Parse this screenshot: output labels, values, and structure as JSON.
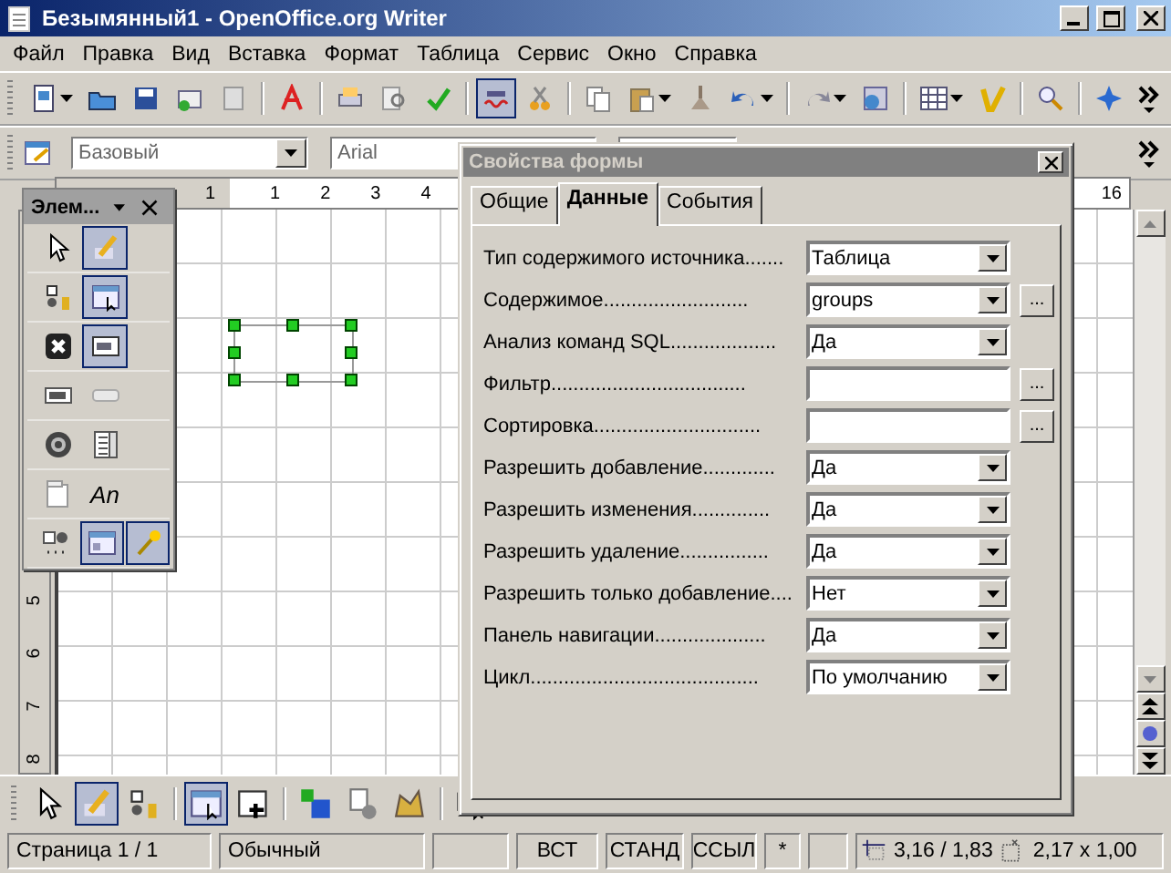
{
  "window": {
    "title": "Безымянный1 - OpenOffice.org Writer"
  },
  "menu": [
    {
      "label": "Файл"
    },
    {
      "label": "Правка"
    },
    {
      "label": "Вид"
    },
    {
      "label": "Вставка"
    },
    {
      "label": "Формат"
    },
    {
      "label": "Таблица"
    },
    {
      "label": "Сервис"
    },
    {
      "label": "Окно"
    },
    {
      "label": "Справка"
    }
  ],
  "standard_toolbar": {
    "buttons": [
      {
        "selected": false
      },
      {
        "selected": false
      },
      {
        "selected": false
      },
      {
        "selected": false
      },
      {
        "selected": false
      },
      {
        "selected": false
      },
      {
        "selected": false
      },
      {
        "selected": false
      },
      {
        "selected": false
      },
      {
        "selected": true
      },
      {
        "selected": false
      },
      {
        "selected": false
      },
      {
        "selected": false
      },
      {
        "selected": false
      },
      {
        "selected": false
      },
      {
        "selected": false
      },
      {
        "selected": false
      },
      {
        "selected": false
      },
      {
        "selected": false
      },
      {
        "selected": false
      },
      {
        "selected": false
      }
    ]
  },
  "formatting_toolbar": {
    "style": "Базовый",
    "font": "Arial"
  },
  "horizontal_ruler": [
    "1",
    "1",
    "2",
    "3",
    "4",
    "16"
  ],
  "vertical_ruler": [
    "5",
    "6",
    "7",
    "8"
  ],
  "form_controls_toolbar": {
    "title": "Элем...",
    "tools": [
      {
        "selected": false
      },
      {
        "selected": true
      },
      {
        "selected": false
      },
      {
        "selected": true
      },
      {
        "selected": false
      },
      {
        "selected": true
      },
      {
        "selected": false
      },
      {
        "selected": false
      },
      {
        "selected": false
      },
      {
        "selected": false
      },
      {
        "selected": false
      },
      {
        "selected": false,
        "text": "An"
      },
      {
        "selected": false
      },
      {
        "selected": true
      },
      {
        "selected": true
      }
    ]
  },
  "form_design_toolbar": {
    "buttons": [
      {
        "selected": false
      },
      {
        "selected": true
      },
      {
        "selected": false
      },
      {
        "selected": true
      },
      {
        "selected": false
      },
      {
        "selected": false
      },
      {
        "selected": false
      },
      {
        "selected": false
      },
      {
        "selected": false
      }
    ]
  },
  "dialog": {
    "title": "Свойства формы",
    "tabs": [
      {
        "label": "Общие",
        "selected": false
      },
      {
        "label": "Данные",
        "selected": true
      },
      {
        "label": "События",
        "selected": false
      }
    ],
    "rows": [
      {
        "label": "Тип содержимого источника.......",
        "kind": "combo",
        "value": "Таблица"
      },
      {
        "label": "Содержимое..........................",
        "kind": "combo",
        "value": "groups",
        "browse": "..."
      },
      {
        "label": "Анализ команд SQL...................",
        "kind": "combo",
        "value": "Да"
      },
      {
        "label": "Фильтр...................................",
        "kind": "text",
        "value": "",
        "browse": "..."
      },
      {
        "label": "Сортировка..............................",
        "kind": "text",
        "value": "",
        "browse": "..."
      },
      {
        "label": "Разрешить добавление.............",
        "kind": "combo",
        "value": "Да"
      },
      {
        "label": "Разрешить изменения..............",
        "kind": "combo",
        "value": "Да"
      },
      {
        "label": "Разрешить удаление................",
        "kind": "combo",
        "value": "Да"
      },
      {
        "label": "Разрешить только добавление....",
        "kind": "combo",
        "value": "Нет"
      },
      {
        "label": "Панель навигации....................",
        "kind": "combo",
        "value": "Да"
      },
      {
        "label": "Цикл.........................................",
        "kind": "combo",
        "value": "По умолчанию"
      }
    ]
  },
  "status_bar": {
    "page": "Страница  1 / 1",
    "page_style": "Обычный",
    "insert_mode": "ВСТ",
    "selection_mode": "СТАНД",
    "hyperlink_mode": "ССЫЛ",
    "modified": "*",
    "position": "3,16 / 1,83",
    "size": "2,17 x 1,00"
  }
}
